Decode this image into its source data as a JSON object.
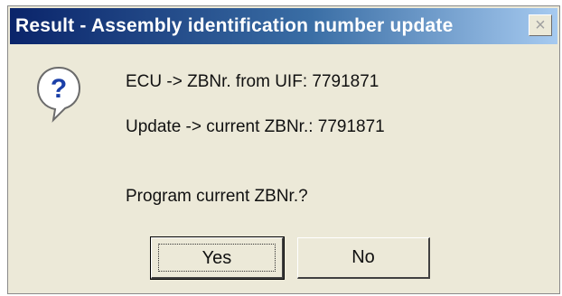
{
  "window": {
    "title": "Result - Assembly identification number update",
    "close_symbol": "×"
  },
  "icons": {
    "dialog_icon": "question-icon"
  },
  "message": {
    "line1": "ECU -> ZBNr. from UIF: 7791871",
    "line2": "Update -> current ZBNr.: 7791871",
    "question": "Program current ZBNr.?"
  },
  "buttons": {
    "yes_label": "Yes",
    "no_label": "No"
  }
}
